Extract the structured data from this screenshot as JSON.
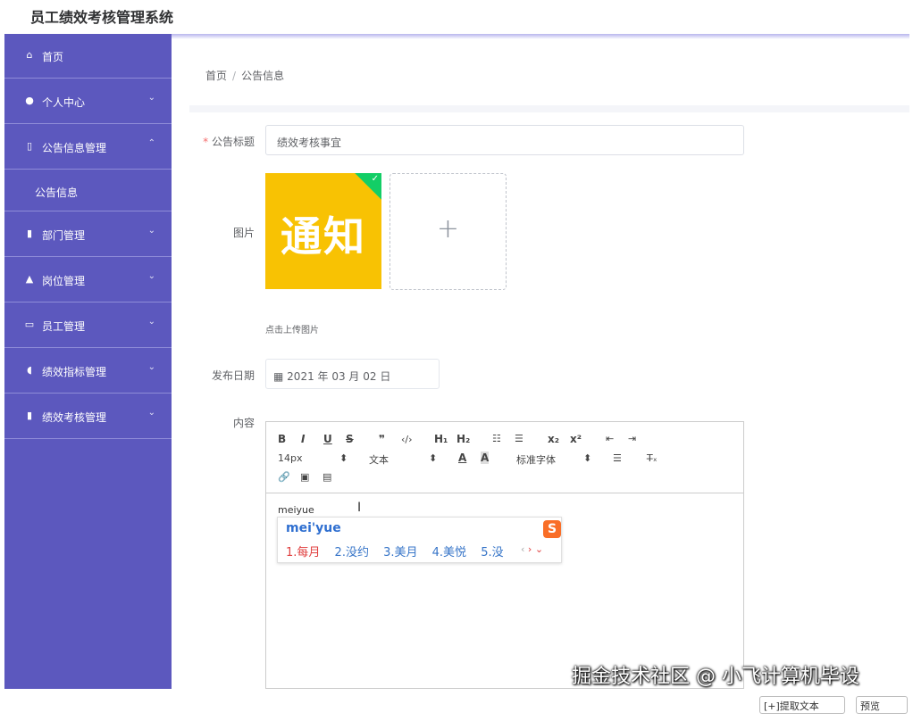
{
  "app": {
    "title": "员工绩效考核管理系统"
  },
  "sidebar": {
    "items": [
      {
        "label": "首页",
        "icon": "home-icon"
      },
      {
        "label": "个人中心",
        "icon": "user-icon"
      },
      {
        "label": "公告信息管理",
        "icon": "phone-icon"
      },
      {
        "label": "部门管理",
        "icon": "folder-icon"
      },
      {
        "label": "岗位管理",
        "icon": "user-icon"
      },
      {
        "label": "员工管理",
        "icon": "id-card-icon"
      },
      {
        "label": "绩效指标管理",
        "icon": "mic-icon"
      },
      {
        "label": "绩效考核管理",
        "icon": "folder-icon"
      }
    ],
    "submenu": {
      "label": "公告信息"
    }
  },
  "breadcrumb": {
    "home": "首页",
    "separator": "/",
    "current": "公告信息"
  },
  "form": {
    "title_label": "公告标题",
    "title_required_mark": "*",
    "title_value": "绩效考核事宜",
    "image_label": "图片",
    "image_text": "通知",
    "upload_plus": "+",
    "upload_tip": "点击上传图片",
    "date_label": "发布日期",
    "date_value": "2021 年 03 月 02 日",
    "content_label": "内容"
  },
  "editor": {
    "toolbar": {
      "bold": "B",
      "italic": "I",
      "underline": "U",
      "strike": "S",
      "quote": "❞",
      "code": "‹/›",
      "h1": "H₁",
      "h2": "H₂",
      "ol": "☷",
      "ul": "☰",
      "sub": "x₂",
      "sup": "x²",
      "outdent": "⇤",
      "indent": "⇥",
      "size": "14px",
      "size_arrow": "⬍",
      "header": "文本",
      "header_arrow": "⬍",
      "color": "A",
      "background": "A",
      "font": "标准字体",
      "font_arrow": "⬍",
      "align": "☰",
      "clean": "T̶ₓ",
      "link": "🔗",
      "image": "▣",
      "video": "▤"
    },
    "content_text": "meiyue",
    "cursor_glyph": "I"
  },
  "ime": {
    "pinyin": "mei'yue",
    "logo": "S",
    "candidates": [
      "1.每月",
      "2.没约",
      "3.美月",
      "4.美悦",
      "5.没"
    ],
    "nav_prev": "‹",
    "nav_next": "›",
    "nav_more": "⌄"
  },
  "watermark": {
    "text": "掘金技术社区 @ 小飞计算机毕设"
  },
  "bottom": {
    "btn1": "[+]提取文本",
    "btn2": "预览"
  },
  "colors": {
    "sidebar_bg": "#5c58be",
    "accent": "#5c58be",
    "required": "#f56c6c",
    "image_bg": "#f8c203",
    "success": "#13ce66"
  }
}
